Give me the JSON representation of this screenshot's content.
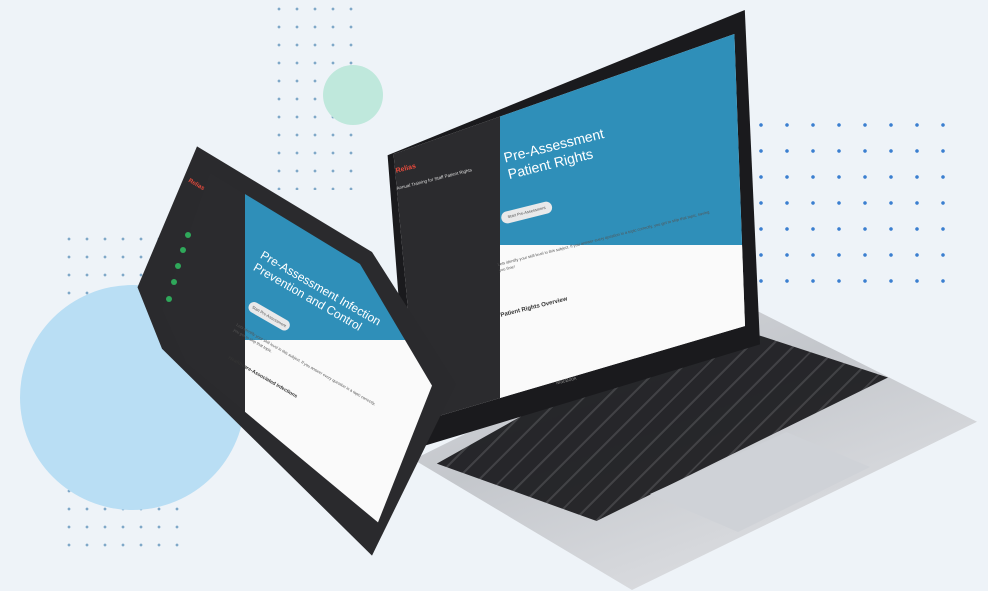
{
  "colors": {
    "background": "#eef3f8",
    "banner_blue": "#2f8fb9",
    "accent_dots": "#3b7fd0",
    "mint_circle": "#bfe8dc",
    "sky_circle": "#b9def4",
    "brand_red": "#e64a3c"
  },
  "laptop": {
    "brand": "Relias",
    "course_title": "Annual Training for Staff Patient Rights",
    "screen_title": "Pre-Assessment Patient Rights",
    "start_button": "Start Pre-Assessment",
    "body_text": "Lets identify your skill level in this subject. If you answer every question in a topic correctly, you get to skip that topic, saving you time!",
    "section_heading": "Patient Rights Overview",
    "base_label": "MacBook"
  },
  "tablet": {
    "brand": "Relias",
    "screen_title": "Pre-Assessment Infection Prevention and Control",
    "start_button": "Start Pre-Assessment",
    "body_text": "Lets identify your skill level in this subject. If you answer every question in a topic correctly, you get to skip that topic.",
    "section_heading": "Healthcare-Associated Infections"
  }
}
